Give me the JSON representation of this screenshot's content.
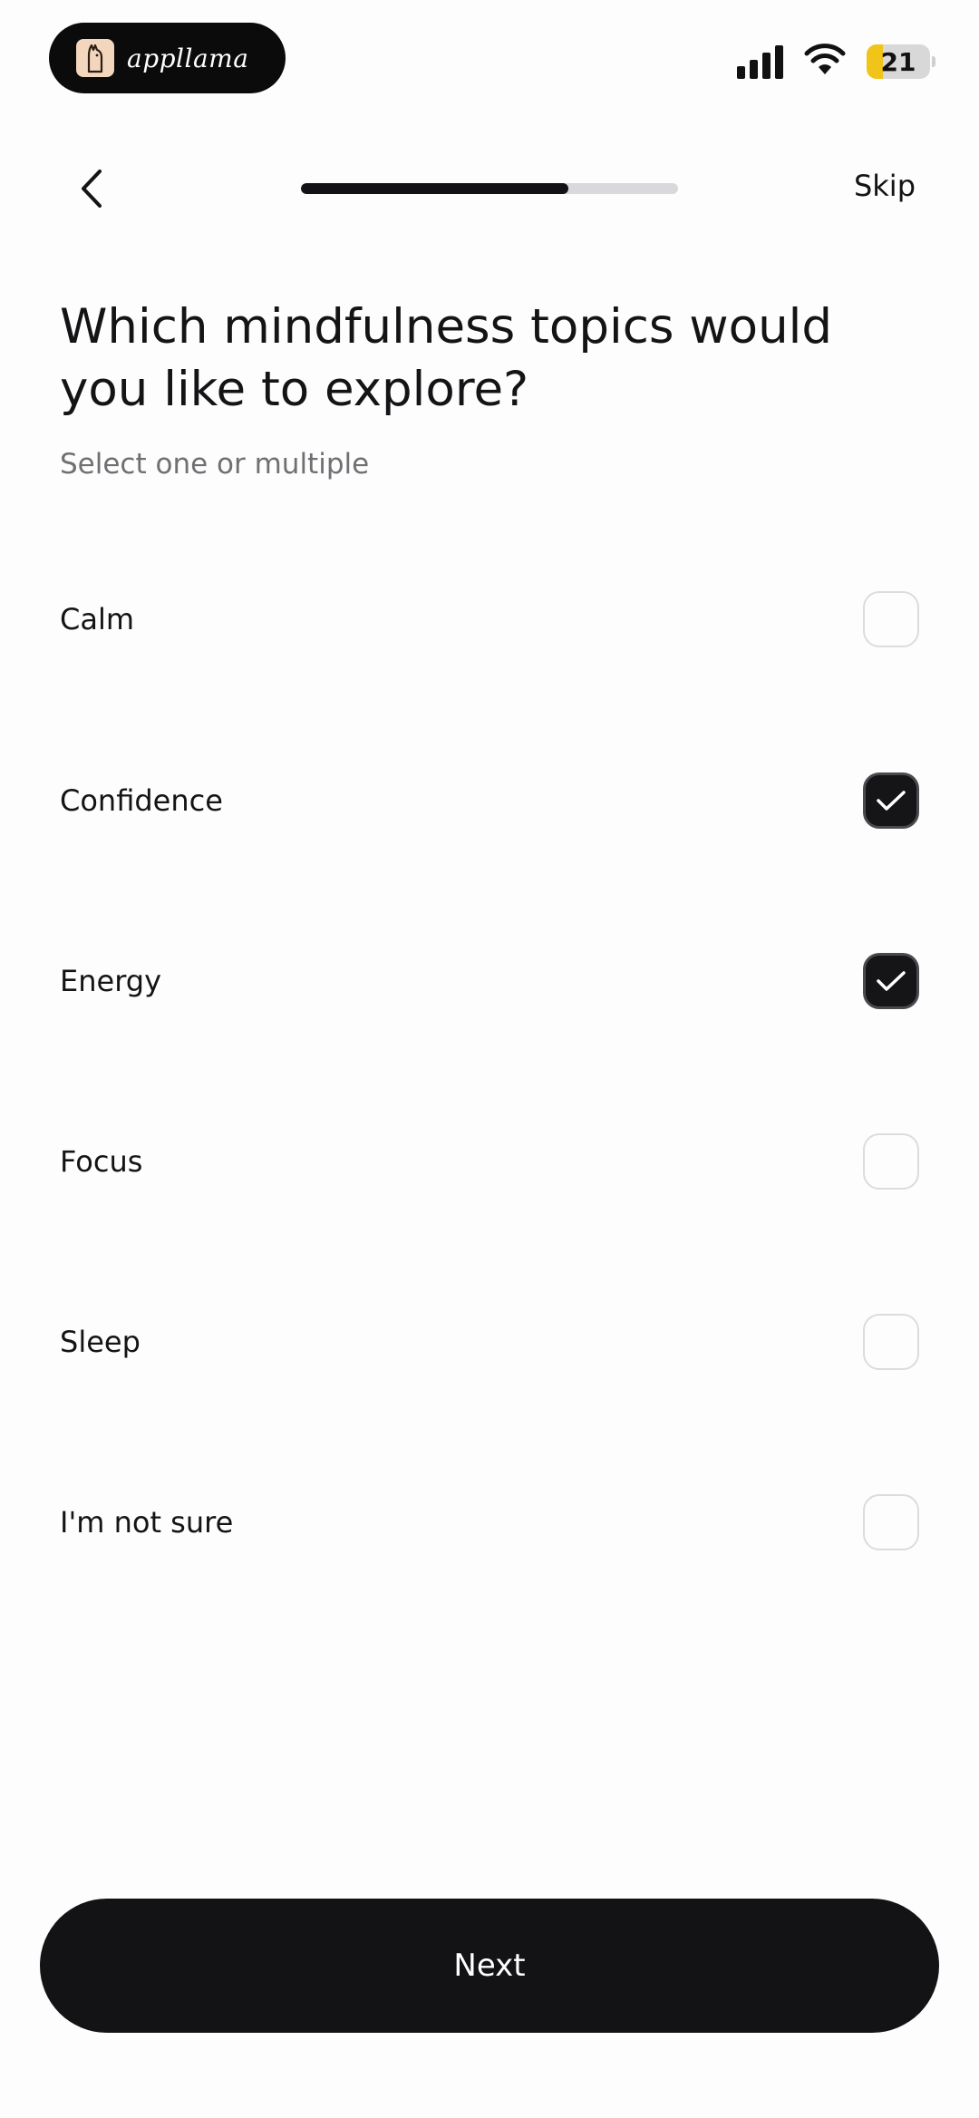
{
  "status_bar": {
    "app_name": "appllama",
    "battery_level": "21",
    "icons": [
      "llama-logo-icon",
      "cellular-signal-icon",
      "wifi-icon",
      "battery-icon"
    ]
  },
  "nav": {
    "back_icon": "chevron-left-icon",
    "skip_label": "Skip",
    "progress_fraction": 0.71
  },
  "question": {
    "title": "Which mindfulness topics would you like to explore?",
    "subtitle": "Select one or multiple"
  },
  "options": [
    {
      "label": "Calm",
      "checked": false
    },
    {
      "label": "Confidence",
      "checked": true
    },
    {
      "label": "Energy",
      "checked": true
    },
    {
      "label": "Focus",
      "checked": false
    },
    {
      "label": "Sleep",
      "checked": false
    },
    {
      "label": "I'm not sure",
      "checked": false
    }
  ],
  "footer": {
    "next_label": "Next"
  },
  "colors": {
    "primary": "#131316",
    "progress_track": "#d9d9db",
    "battery_fill": "#f0c419",
    "subtitle_text": "#707074"
  }
}
